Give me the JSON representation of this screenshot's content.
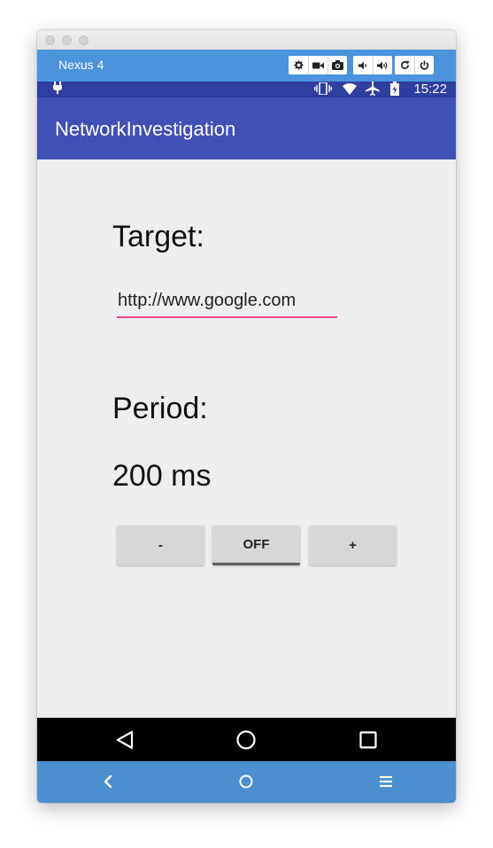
{
  "window": {
    "device_name": "Nexus 4"
  },
  "toolbar": {
    "icons": [
      "gear-icon",
      "video-camera-icon",
      "camera-icon",
      "volume-down-icon",
      "volume-up-icon",
      "rotate-icon",
      "power-icon"
    ]
  },
  "status_bar": {
    "time": "15:22",
    "icons": [
      "usb-icon",
      "vibrate-icon",
      "wifi-icon",
      "airplane-icon",
      "battery-icon"
    ]
  },
  "app_bar": {
    "title": "NetworkInvestigation",
    "color": "#3f51b5"
  },
  "main": {
    "target_label": "Target:",
    "target_value": "http://www.google.com",
    "period_label": "Period:",
    "period_value": "200 ms",
    "buttons": {
      "minus": "-",
      "toggle": "OFF",
      "plus": "+"
    },
    "accent_color": "#e94a8a"
  },
  "android_nav": {
    "icons": [
      "back-triangle-icon",
      "home-circle-icon",
      "recents-square-icon"
    ]
  },
  "emulator_nav": {
    "icons": [
      "chevron-left-icon",
      "home-circle-icon",
      "menu-icon"
    ],
    "color": "#4b8fd1"
  }
}
